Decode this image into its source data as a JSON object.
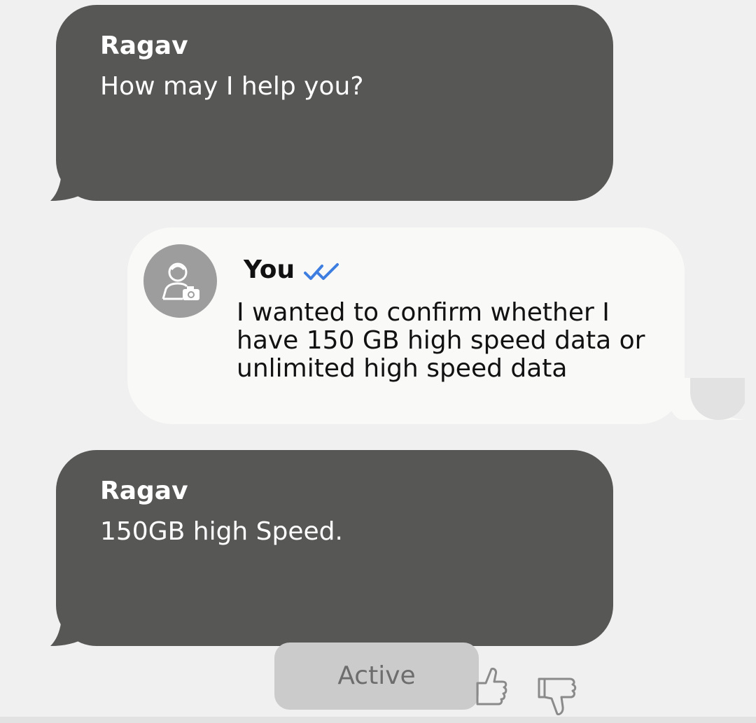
{
  "messages": [
    {
      "sender": "Ragav",
      "text": "How may I help you?"
    },
    {
      "sender": "You",
      "text": "I wanted to confirm whether I have 150 GB high speed data or unlimited high speed data",
      "status_icon": "double-check-icon"
    },
    {
      "sender": "Ragav",
      "text": "150GB high Speed."
    }
  ],
  "status": {
    "label": "Active"
  },
  "feedback": {
    "like_icon": "thumbs-up-icon",
    "dislike_icon": "thumbs-down-icon"
  },
  "colors": {
    "agent_bubble": "#575756",
    "user_bubble": "#f9f9f7",
    "background": "#f0f0f0",
    "read_check": "#3d7ee0",
    "status_pill": "#cbcbcb"
  }
}
